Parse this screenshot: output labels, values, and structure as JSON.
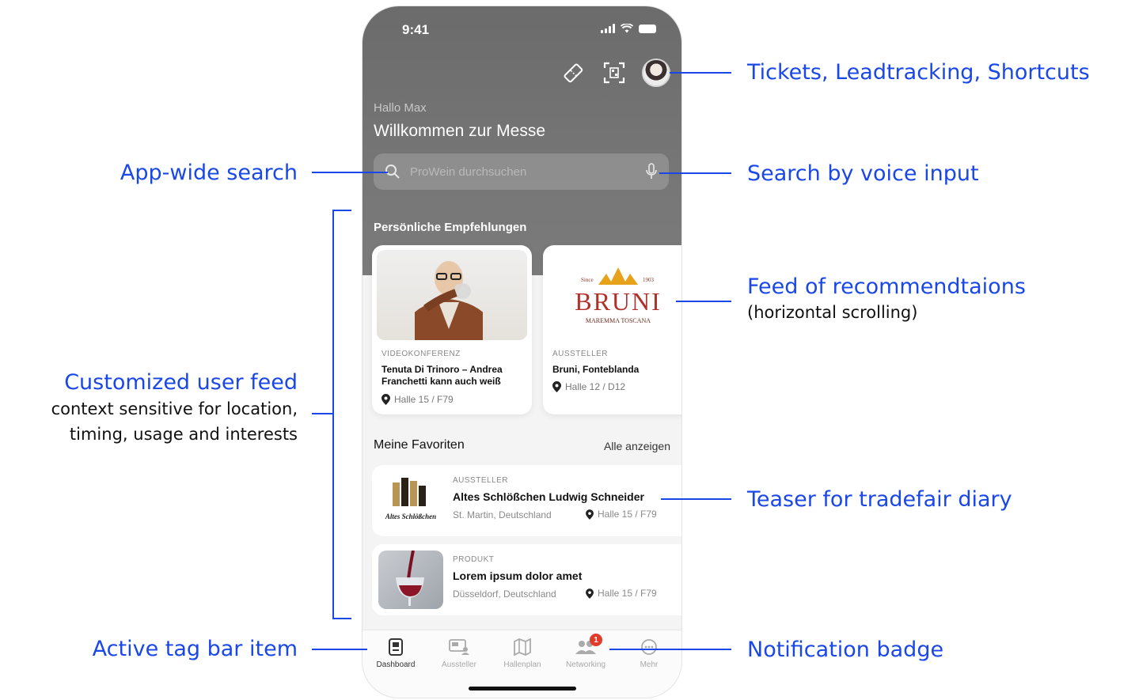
{
  "phone": {
    "status_time": "9:41",
    "hello": "Hallo Max",
    "welcome": "Willkommen zur Messe",
    "search_placeholder": "ProWein durchsuchen",
    "recommendations_title": "Persönliche Empfehlungen",
    "cards": [
      {
        "category": "VIDEOKONFERENZ",
        "title": "Tenuta Di Trinoro – Andrea Franchetti kann auch weiß",
        "location": "Halle 15 / F79"
      },
      {
        "category": "AUSSTELLER",
        "title": "Bruni, Fonteblanda",
        "location": "Halle 12 / D12",
        "logo": {
          "since_left": "Since",
          "since_right": "1903",
          "name": "BRUNI",
          "tagline": "MAREMMA TOSCANA"
        }
      }
    ],
    "favorites": {
      "title": "Meine Favoriten",
      "show_all": "Alle anzeigen",
      "items": [
        {
          "category": "AUSSTELLER",
          "title": "Altes Schlößchen Ludwig Schneider",
          "city": "St. Martin, Deutschland",
          "location": "Halle 15 / F79",
          "logo_text": "Altes Schlößchen"
        },
        {
          "category": "PRODUKT",
          "title": "Lorem ipsum dolor amet",
          "city": "Düsseldorf, Deutschland",
          "location": "Halle 15 / F79"
        }
      ]
    },
    "tabs": [
      {
        "label": "Dashboard",
        "icon": "dashboard-icon"
      },
      {
        "label": "Aussteller",
        "icon": "exhibitor-icon"
      },
      {
        "label": "Hallenplan",
        "icon": "map-icon"
      },
      {
        "label": "Networking",
        "icon": "people-icon",
        "badge": "1"
      },
      {
        "label": "Mehr",
        "icon": "more-icon"
      }
    ]
  },
  "annotations": {
    "tickets": "Tickets, Leadtracking, Shortcuts",
    "search": "App-wide search",
    "voice": "Search  by voice input",
    "feed_recs": "Feed of recommendtaions",
    "feed_recs_sub": "(horizontal scrolling)",
    "custom_feed": "Customized user feed",
    "custom_feed_sub1": "context sensitive for location,",
    "custom_feed_sub2": "timing, usage and interests",
    "diary": "Teaser for tradefair diary",
    "active_tab": "Active tag bar item",
    "badge": "Notification badge"
  },
  "colors": {
    "annotation": "#1a47e8",
    "badge": "#e23a2b",
    "header_bg": "#6b6b6b"
  }
}
